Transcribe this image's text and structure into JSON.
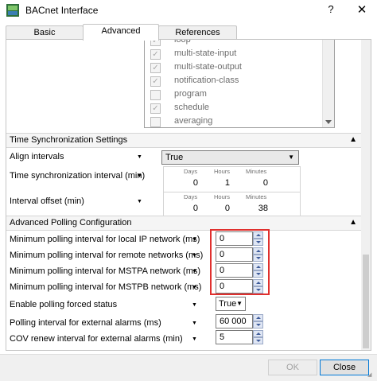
{
  "window": {
    "title": "BACnet Interface",
    "help_label": "?",
    "close_label": "✕"
  },
  "tabs": [
    {
      "label": "Basic",
      "active": false
    },
    {
      "label": "Advanced",
      "active": true
    },
    {
      "label": "References",
      "active": false
    }
  ],
  "object_list": {
    "items": [
      {
        "label": "loop",
        "checked": true
      },
      {
        "label": "multi-state-input",
        "checked": true
      },
      {
        "label": "multi-state-output",
        "checked": true
      },
      {
        "label": "notification-class",
        "checked": true
      },
      {
        "label": "program",
        "checked": false
      },
      {
        "label": "schedule",
        "checked": true
      },
      {
        "label": "averaging",
        "checked": false
      }
    ]
  },
  "time_sync": {
    "section_title": "Time Synchronization Settings",
    "align_label": "Align intervals",
    "align_value": "True",
    "interval_label": "Time synchronization interval (min)",
    "interval": {
      "days": "0",
      "hours": "1",
      "minutes": "0"
    },
    "offset_label": "Interval offset (min)",
    "offset": {
      "days": "0",
      "hours": "0",
      "minutes": "38"
    },
    "headers": {
      "days": "Days",
      "hours": "Hours",
      "minutes": "Minutes"
    }
  },
  "polling": {
    "section_title": "Advanced Polling Configuration",
    "rows": [
      {
        "label": "Minimum polling interval for local IP network (ms)",
        "value": "0"
      },
      {
        "label": "Minimum polling interval for remote networks (ms)",
        "value": "0"
      },
      {
        "label": "Minimum polling interval for MSTPA network (ms)",
        "value": "0"
      },
      {
        "label": "Minimum polling interval for MSTPB network (ms)",
        "value": "0"
      }
    ],
    "forced_label": "Enable polling forced status",
    "forced_value": "True",
    "ext_alarm_label": "Polling interval for external alarms (ms)",
    "ext_alarm_value": "60 000",
    "cov_label": "COV renew interval for external alarms (min)",
    "cov_value": "5"
  },
  "footer": {
    "ok_label": "OK",
    "close_label": "Close"
  },
  "colors": {
    "highlight": "#e0302e",
    "primary_border": "#0078d7"
  }
}
